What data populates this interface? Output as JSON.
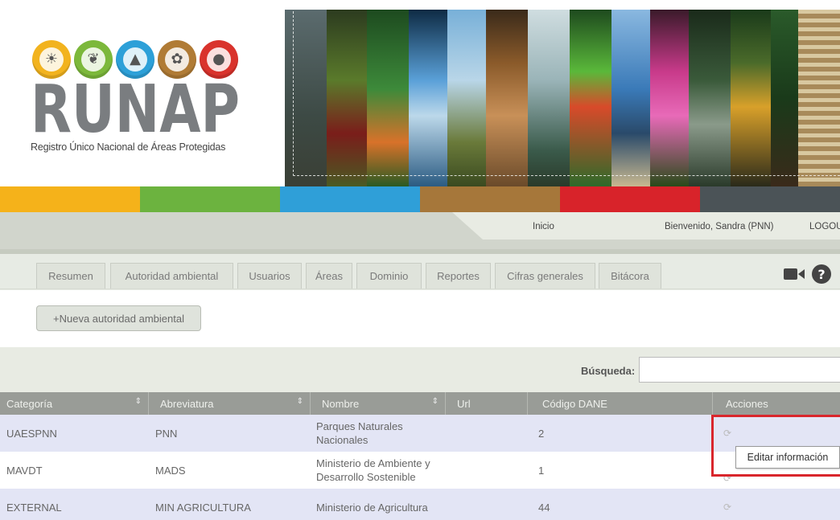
{
  "logo": {
    "wordmark": "RUNAP",
    "subtitle": "Registro Único Nacional de Áreas Protegidas",
    "circle_icons": [
      "sun-palm-icon",
      "leaf-icon",
      "mountain-icon",
      "plant-icon",
      "bear-icon"
    ]
  },
  "nav": {
    "inicio": "Inicio",
    "welcome": "Bienvenido, Sandra (PNN)",
    "logout": "LOGOUT"
  },
  "tabs": [
    "Resumen",
    "Autoridad ambiental",
    "Usuarios",
    "Áreas",
    "Dominio",
    "Reportes",
    "Cifras generales",
    "Bitácora"
  ],
  "new_button": "+Nueva autoridad ambiental",
  "search": {
    "label": "Búsqueda:",
    "value": ""
  },
  "table": {
    "headers": [
      "Categoría",
      "Abreviatura",
      "Nombre",
      "Url",
      "Código DANE",
      "Acciones"
    ],
    "rows": [
      {
        "categoria": "UAESPNN",
        "abreviatura": "PNN",
        "nombre": "Parques Naturales Nacionales",
        "url": "",
        "dane": "2"
      },
      {
        "categoria": "MAVDT",
        "abreviatura": "MADS",
        "nombre": "Ministerio de Ambiente y Desarrollo Sostenible",
        "url": "",
        "dane": "1"
      },
      {
        "categoria": "EXTERNAL",
        "abreviatura": "MIN AGRICULTURA",
        "nombre": "Ministerio de Agricultura",
        "url": "",
        "dane": "44"
      }
    ]
  },
  "tooltip": "Editar información",
  "colors": {
    "bar": [
      "#f5b21a",
      "#6cb33f",
      "#2f9fd8",
      "#a6773a",
      "#d8232a",
      "#4b5357"
    ],
    "row_odd": "#e3e5f5",
    "header_bg": "#999c97",
    "highlight": "#d9262c"
  }
}
